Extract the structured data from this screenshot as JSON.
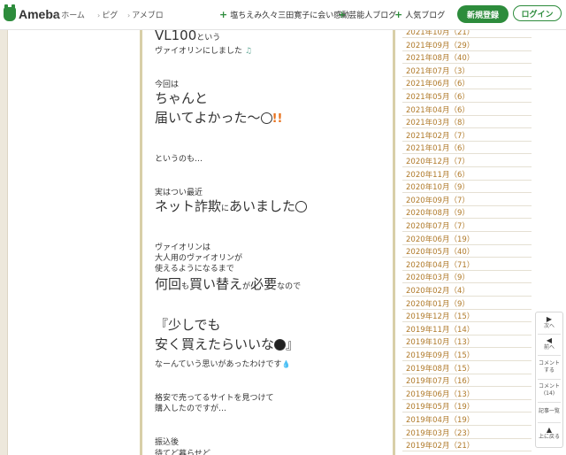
{
  "header": {
    "logo": "Ameba",
    "nav": [
      "ホーム",
      "ピグ",
      "アメブロ"
    ],
    "links": [
      "塩ちえみ久々三田寛子に会い感動",
      "芸能人ブログ",
      "人気ブログ"
    ],
    "signup_label": "新規登録",
    "login_label": "ログイン"
  },
  "article": {
    "l1": "VL100",
    "l1b": "という",
    "l2": "ヴァイオリンにしました",
    "l3": "今回は",
    "l4": "ちゃんと",
    "l5": "届いてよかった〜",
    "l6": "というのも…",
    "l7": "実はつい最近",
    "l8a": "ネット詐欺",
    "l8b": "に",
    "l8c": "あいました",
    "l9": "ヴァイオリンは",
    "l10": "大人用のヴァイオリンが",
    "l11": "使えるようになるまで",
    "l12a": "何回",
    "l12b": "も",
    "l12c": "買い替え",
    "l12d": "が",
    "l12e": "必要",
    "l12f": "なので",
    "l13": "『少しでも",
    "l14": "安く買えたらいいな",
    "l14b": "』",
    "l15": "なーんていう思いがあったわけです",
    "l16": "格安で売ってるサイトを見つけて",
    "l17": "購入したのですが…",
    "l18": "振込後",
    "l19": "待てど暮らせど"
  },
  "archive": [
    "2021年10月（21）",
    "2021年09月（29）",
    "2021年08月（40）",
    "2021年07月（3）",
    "2021年06月（6）",
    "2021年05月（6）",
    "2021年04月（6）",
    "2021年03月（8）",
    "2021年02月（7）",
    "2021年01月（6）",
    "2020年12月（7）",
    "2020年11月（6）",
    "2020年10月（9）",
    "2020年09月（7）",
    "2020年08月（9）",
    "2020年07月（7）",
    "2020年06月（19）",
    "2020年05月（40）",
    "2020年04月（71）",
    "2020年03月（9）",
    "2020年02月（4）",
    "2020年01月（9）",
    "2019年12月（15）",
    "2019年11月（14）",
    "2019年10月（13）",
    "2019年09月（15）",
    "2019年08月（15）",
    "2019年07月（16）",
    "2019年06月（13）",
    "2019年05月（19）",
    "2019年04月（19）",
    "2019年03月（23）",
    "2019年02月（21）"
  ],
  "float_nav": {
    "next": "次へ",
    "prev": "前へ",
    "comment_l1": "コメント",
    "comment_l2": "する",
    "comments_l1": "コメント",
    "comments_l2": "(14)",
    "list": "記事一覧",
    "top": "上に戻る"
  },
  "colors": {
    "brand": "#2d8c3c",
    "archive_link": "#b07a2a",
    "column_border": "#d8cfa8"
  }
}
